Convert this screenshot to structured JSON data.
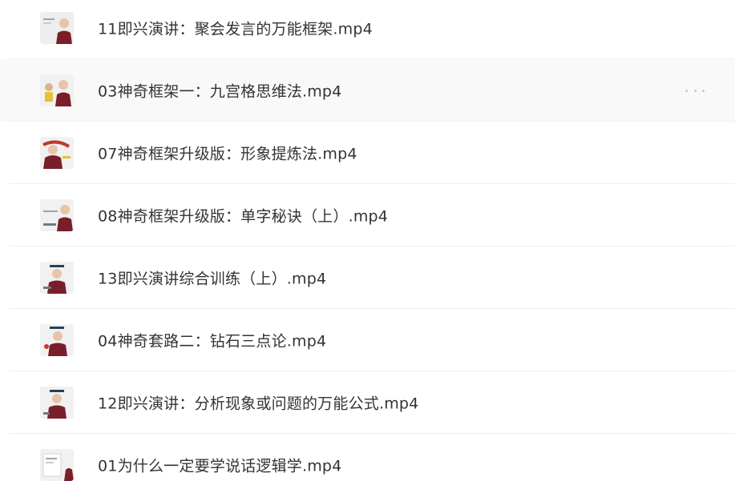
{
  "files": [
    {
      "name": "11即兴演讲：聚会发言的万能框架.mp4",
      "thumb": "video-thumbnail-icon"
    },
    {
      "name": "03神奇框架一：九宫格思维法.mp4",
      "thumb": "video-thumbnail-icon",
      "hovered": true
    },
    {
      "name": "07神奇框架升级版：形象提炼法.mp4",
      "thumb": "video-thumbnail-icon"
    },
    {
      "name": "08神奇框架升级版：单字秘诀（上）.mp4",
      "thumb": "video-thumbnail-icon"
    },
    {
      "name": "13即兴演讲综合训练（上）.mp4",
      "thumb": "video-thumbnail-icon"
    },
    {
      "name": "04神奇套路二：钻石三点论.mp4",
      "thumb": "video-thumbnail-icon"
    },
    {
      "name": "12即兴演讲：分析现象或问题的万能公式.mp4",
      "thumb": "video-thumbnail-icon"
    },
    {
      "name": "01为什么一定要学说话逻辑学.mp4",
      "thumb": "video-thumbnail-icon"
    }
  ],
  "more_icon": "more-options-icon",
  "colors": {
    "text": "#333333",
    "hover_bg": "#f9f9f9",
    "divider": "#eeeeee",
    "suit": "#7a1e2a"
  }
}
